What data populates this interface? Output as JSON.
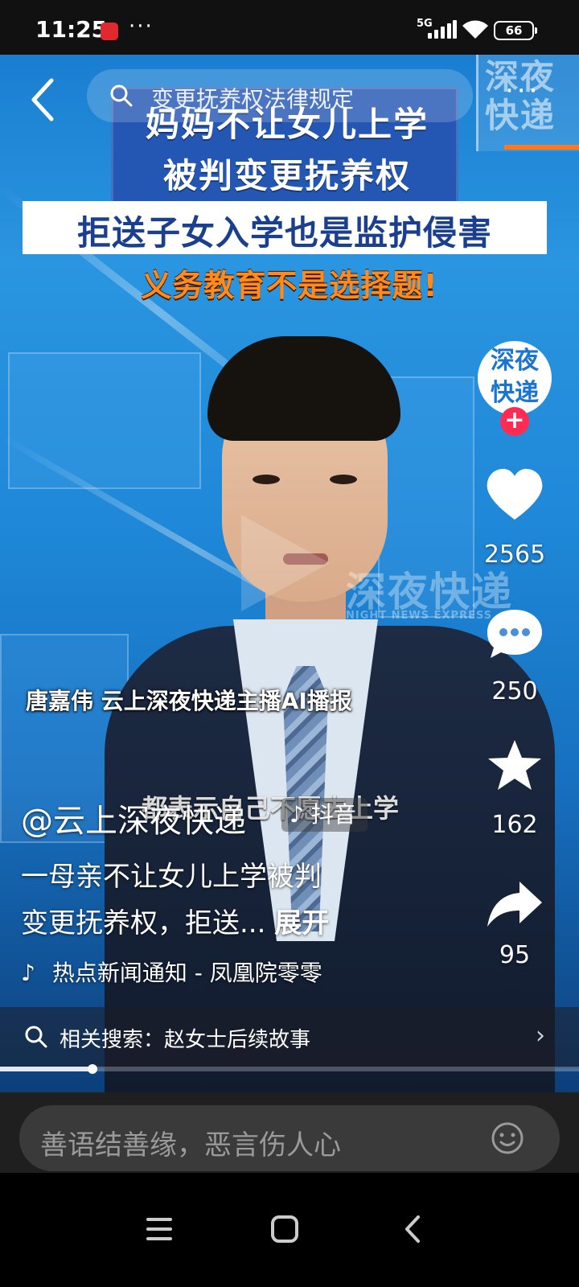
{
  "status_bar": {
    "time": "11:25",
    "dots": "···",
    "network": "5G",
    "battery": "66"
  },
  "top_bar": {
    "search_text": "变更抚养权法律规定",
    "more_dots": "···"
  },
  "video": {
    "brand_corner": "深夜快递",
    "headline_line1": "妈妈不让女儿上学",
    "headline_line2": "被判变更抚养权",
    "subheadline": "拒送子女入学也是监护侵害",
    "tagline": "义务教育不是选择题!",
    "watermark": "深夜快递",
    "watermark_sub": "NIGHT NEWS EXPRESS",
    "caption_name": "唐嘉伟 云上深夜快递主播AI播报",
    "caption_subtitle": "都表示自己不愿去上学"
  },
  "rail": {
    "avatar_text": "深夜快递",
    "follow": "+",
    "likes": "2565",
    "comments": "250",
    "favorites": "162",
    "shares": "95"
  },
  "description": {
    "author": "@云上深夜快递",
    "platform_badge": "抖音",
    "line1": "一母亲不让女儿上学被判",
    "line2": "变更抚养权，拒送...",
    "expand": "展开",
    "music": "热点新闻通知 - 凤凰院零零"
  },
  "related_search": {
    "text": "相关搜索：赵女士后续故事",
    "arrow": "›"
  },
  "progress": {
    "fraction": 0.16
  },
  "comment": {
    "placeholder": "善语结善缘，恶言伤人心"
  },
  "colors": {
    "accent_red": "#fe2c55",
    "headline_blue": "#2457b3",
    "tagline_orange": "#ff8a1e"
  },
  "icons": [
    "back-icon",
    "search-icon",
    "more-icon",
    "heart-icon",
    "comment-icon",
    "star-icon",
    "share-icon",
    "music-icon",
    "emoji-icon",
    "menu-icon",
    "home-icon",
    "back-nav-icon"
  ]
}
